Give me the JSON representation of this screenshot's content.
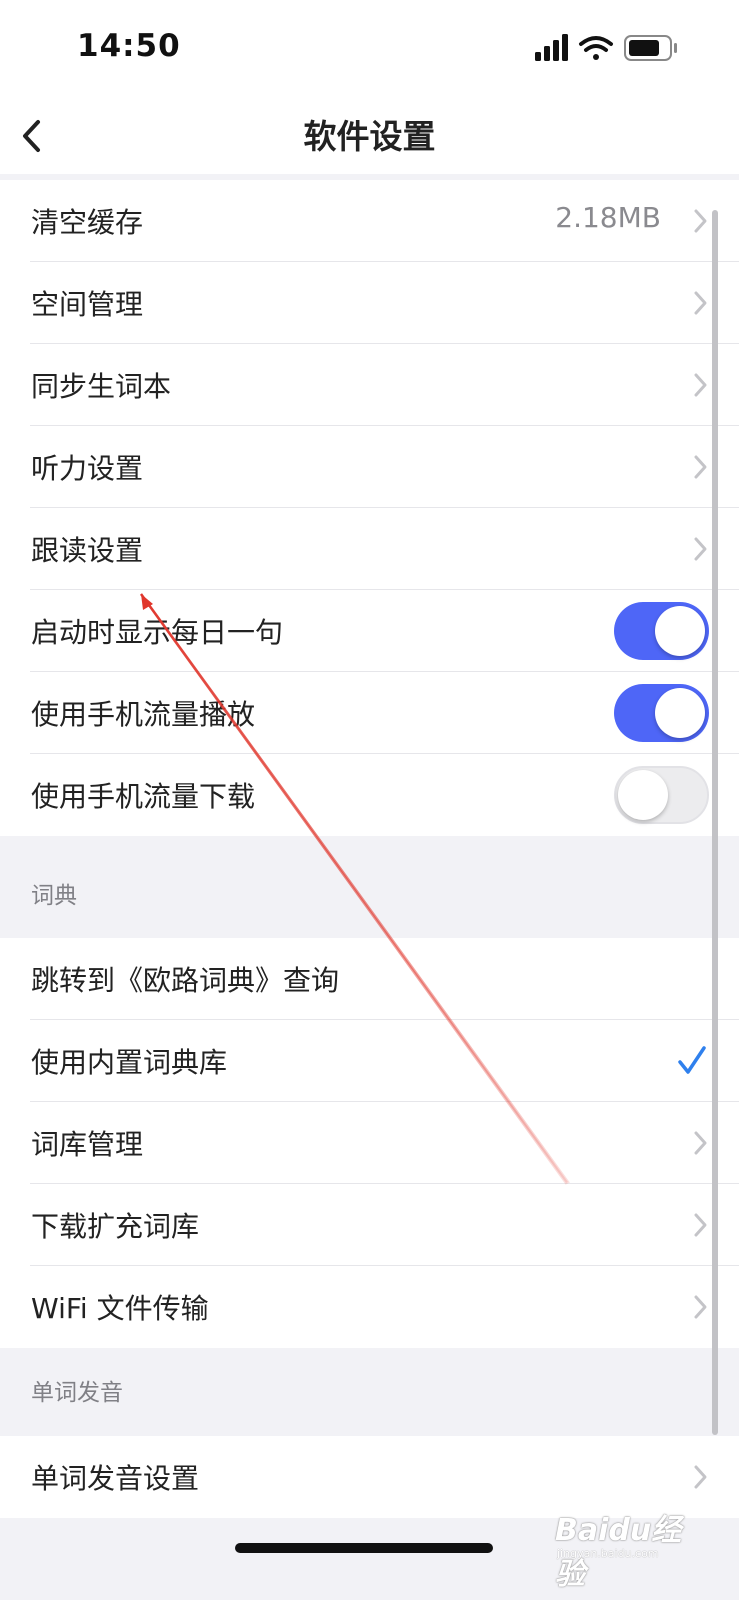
{
  "status_bar": {
    "time": "14:50"
  },
  "nav": {
    "title": "软件设置"
  },
  "settings": {
    "clear_cache": {
      "label": "清空缓存",
      "value": "2.18MB"
    },
    "space_management": {
      "label": "空间管理"
    },
    "sync_wordbook": {
      "label": "同步生词本"
    },
    "listening_settings": {
      "label": "听力设置"
    },
    "shadowing_settings": {
      "label": "跟读设置"
    },
    "daily_sentence": {
      "label": "启动时显示每日一句",
      "enabled": true
    },
    "cellular_playback": {
      "label": "使用手机流量播放",
      "enabled": true
    },
    "cellular_download": {
      "label": "使用手机流量下载",
      "enabled": false
    }
  },
  "dictionary": {
    "header": "词典",
    "jump_eudic": {
      "label": "跳转到《欧路词典》查询"
    },
    "builtin_dictionary": {
      "label": "使用内置词典库",
      "checked": true
    },
    "library_management": {
      "label": "词库管理"
    },
    "download_extended": {
      "label": "下载扩充词库"
    },
    "wifi_transfer": {
      "label": "WiFi 文件传输"
    }
  },
  "pronunciation": {
    "header": "单词发音",
    "settings": {
      "label": "单词发音设置"
    }
  },
  "watermark": {
    "brand": "Baidu经验",
    "url": "jingyan.baidu.com"
  },
  "colors": {
    "accent": "#4e66f7",
    "annotation_arrow": "#e0362c",
    "check": "#2f80ed"
  }
}
